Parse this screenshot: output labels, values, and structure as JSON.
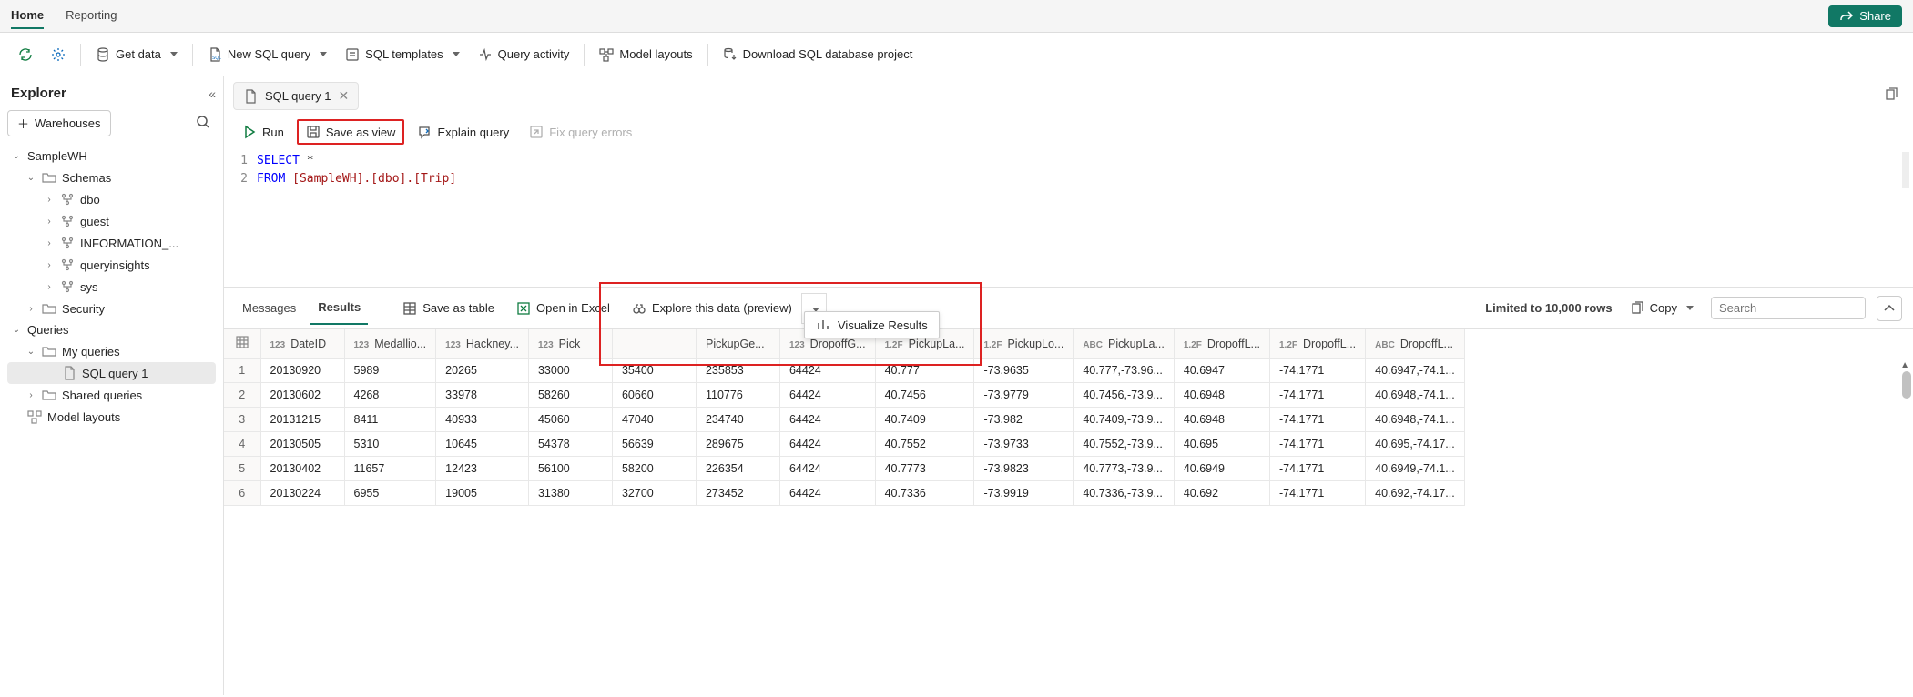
{
  "topTabs": {
    "home": "Home",
    "reporting": "Reporting"
  },
  "share": "Share",
  "toolbar": {
    "getData": "Get data",
    "newQuery": "New SQL query",
    "templates": "SQL templates",
    "activity": "Query activity",
    "modelLayouts": "Model layouts",
    "download": "Download SQL database project"
  },
  "explorer": {
    "title": "Explorer",
    "warehouses": "Warehouses",
    "tree": {
      "sampleWH": "SampleWH",
      "schemas": "Schemas",
      "dbo": "dbo",
      "guest": "guest",
      "info": "INFORMATION_...",
      "qins": "queryinsights",
      "sys": "sys",
      "security": "Security",
      "queries": "Queries",
      "myq": "My queries",
      "sq1": "SQL query 1",
      "shared": "Shared queries",
      "modelLayouts": "Model layouts"
    }
  },
  "fileTab": "SQL query 1",
  "queryToolbar": {
    "run": "Run",
    "saveView": "Save as view",
    "explain": "Explain query",
    "fix": "Fix query errors"
  },
  "sql": {
    "line1a": "SELECT",
    "line1b": " *",
    "line2a": "FROM",
    "line2b": " [SampleWH].[dbo].[Trip]"
  },
  "resultsBar": {
    "messages": "Messages",
    "results": "Results",
    "saveTable": "Save as table",
    "excel": "Open in Excel",
    "explore": "Explore this data (preview)",
    "visualize": "Visualize Results",
    "limited": "Limited to 10,000 rows",
    "copy": "Copy",
    "searchPH": "Search"
  },
  "grid": {
    "columns": [
      {
        "type": "123",
        "label": "DateID"
      },
      {
        "type": "123",
        "label": "Medallio..."
      },
      {
        "type": "123",
        "label": "Hackney..."
      },
      {
        "type": "123",
        "label": "Pick"
      },
      {
        "type": "",
        "label": ""
      },
      {
        "type": "",
        "label": "PickupGe..."
      },
      {
        "type": "123",
        "label": "DropoffG..."
      },
      {
        "type": "1.2F",
        "label": "PickupLa..."
      },
      {
        "type": "1.2F",
        "label": "PickupLo..."
      },
      {
        "type": "ABC",
        "label": "PickupLa..."
      },
      {
        "type": "1.2F",
        "label": "DropoffL..."
      },
      {
        "type": "1.2F",
        "label": "DropoffL..."
      },
      {
        "type": "ABC",
        "label": "DropoffL..."
      }
    ],
    "rows": [
      [
        "1",
        "20130920",
        "5989",
        "20265",
        "33000",
        "35400",
        "235853",
        "64424",
        "40.777",
        "-73.9635",
        "40.777,-73.96...",
        "40.6947",
        "-74.1771",
        "40.6947,-74.1..."
      ],
      [
        "2",
        "20130602",
        "4268",
        "33978",
        "58260",
        "60660",
        "110776",
        "64424",
        "40.7456",
        "-73.9779",
        "40.7456,-73.9...",
        "40.6948",
        "-74.1771",
        "40.6948,-74.1..."
      ],
      [
        "3",
        "20131215",
        "8411",
        "40933",
        "45060",
        "47040",
        "234740",
        "64424",
        "40.7409",
        "-73.982",
        "40.7409,-73.9...",
        "40.6948",
        "-74.1771",
        "40.6948,-74.1..."
      ],
      [
        "4",
        "20130505",
        "5310",
        "10645",
        "54378",
        "56639",
        "289675",
        "64424",
        "40.7552",
        "-73.9733",
        "40.7552,-73.9...",
        "40.695",
        "-74.1771",
        "40.695,-74.17..."
      ],
      [
        "5",
        "20130402",
        "11657",
        "12423",
        "56100",
        "58200",
        "226354",
        "64424",
        "40.7773",
        "-73.9823",
        "40.7773,-73.9...",
        "40.6949",
        "-74.1771",
        "40.6949,-74.1..."
      ],
      [
        "6",
        "20130224",
        "6955",
        "19005",
        "31380",
        "32700",
        "273452",
        "64424",
        "40.7336",
        "-73.9919",
        "40.7336,-73.9...",
        "40.692",
        "-74.1771",
        "40.692,-74.17..."
      ]
    ]
  }
}
